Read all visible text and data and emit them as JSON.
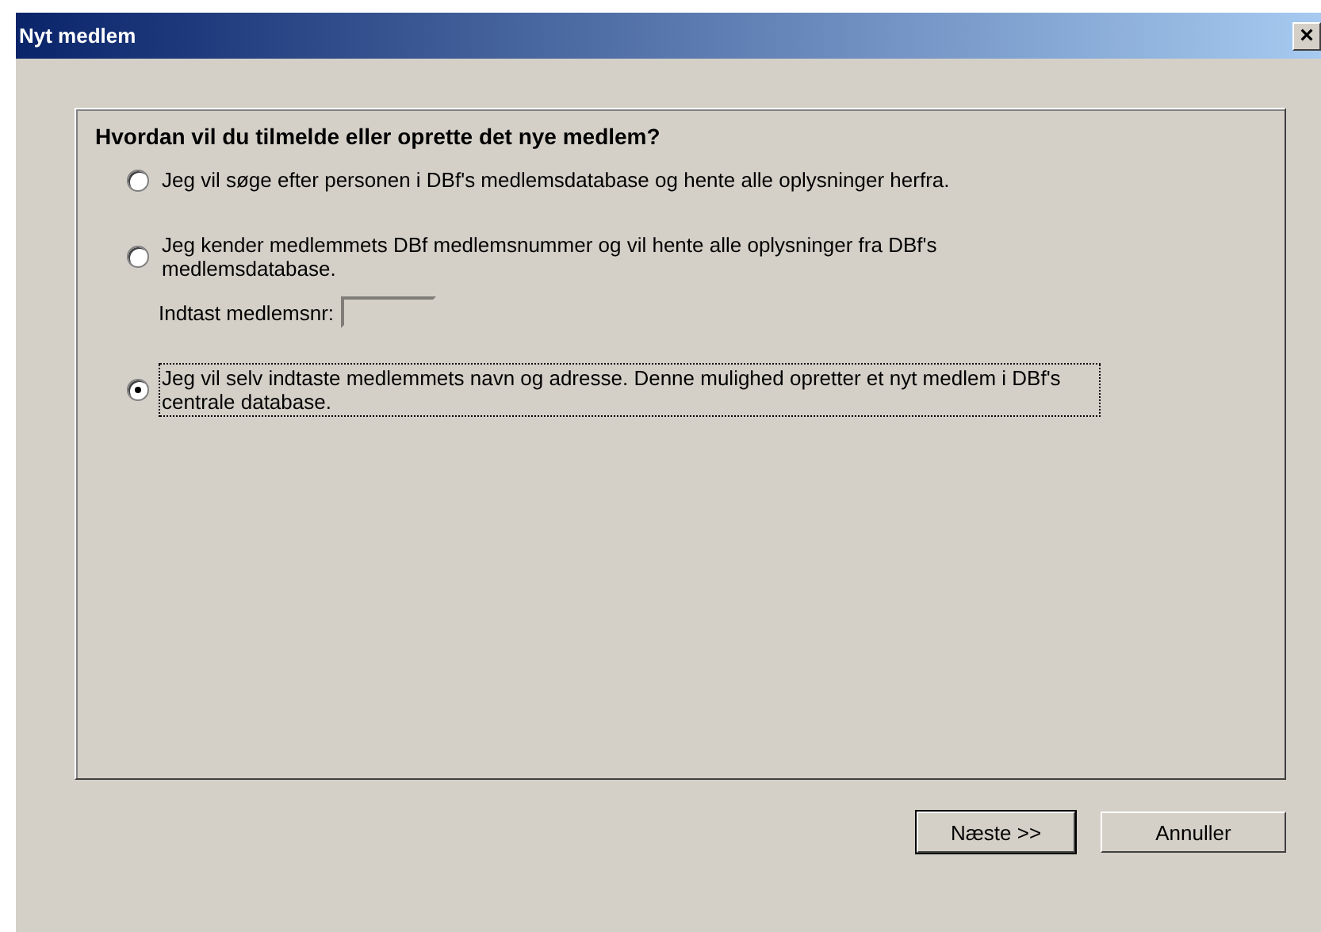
{
  "window": {
    "title": "Nyt medlem",
    "close": "×"
  },
  "question": "Hvordan vil du tilmelde eller oprette det nye medlem?",
  "options": [
    {
      "label": "Jeg vil søge efter personen i DBf's medlemsdatabase og hente alle oplysninger herfra.",
      "selected": false
    },
    {
      "label": "Jeg kender medlemmets DBf medlemsnummer og vil hente alle oplysninger fra DBf's medlemsdatabase.",
      "selected": false,
      "field": {
        "label": "Indtast medlemsnr:",
        "disabled": true
      }
    },
    {
      "label": "Jeg vil selv indtaste medlemmets navn og adresse. Denne mulighed opretter et nyt medlem i DBf's centrale database.",
      "selected": true
    }
  ],
  "buttons": [
    {
      "label": "Næste >>",
      "default": true
    },
    {
      "label": "Annuller",
      "default": false
    }
  ]
}
